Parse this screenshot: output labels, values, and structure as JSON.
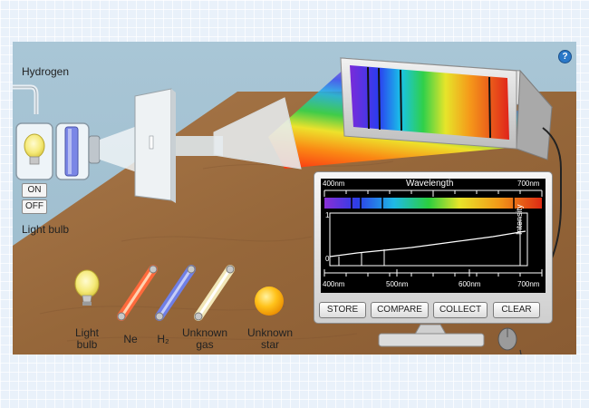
{
  "help": {
    "label": "?"
  },
  "sources": {
    "active_label": "Hydrogen",
    "on_label": "ON",
    "off_label": "OFF",
    "bulb_caption": "Light bulb"
  },
  "tray": {
    "items": [
      {
        "label": "Light\nbulb"
      },
      {
        "label": "Ne"
      },
      {
        "label": "H₂"
      },
      {
        "label": "Unknown\ngas"
      },
      {
        "label": "Unknown\nstar"
      }
    ]
  },
  "monitor": {
    "title": "Wavelength",
    "top_left": "400nm",
    "top_right": "700nm",
    "bottom_ticks": [
      "400nm",
      "500nm",
      "600nm",
      "700nm"
    ],
    "y_top": "1",
    "y_bottom": "0",
    "intensity_label": "Intensity",
    "buttons": [
      "STORE",
      "COMPARE",
      "COLLECT",
      "CLEAR"
    ]
  },
  "colors": {
    "table": "#9b6a3d",
    "wall": "#a6c3d3",
    "button_accent": "#2a78c8"
  }
}
